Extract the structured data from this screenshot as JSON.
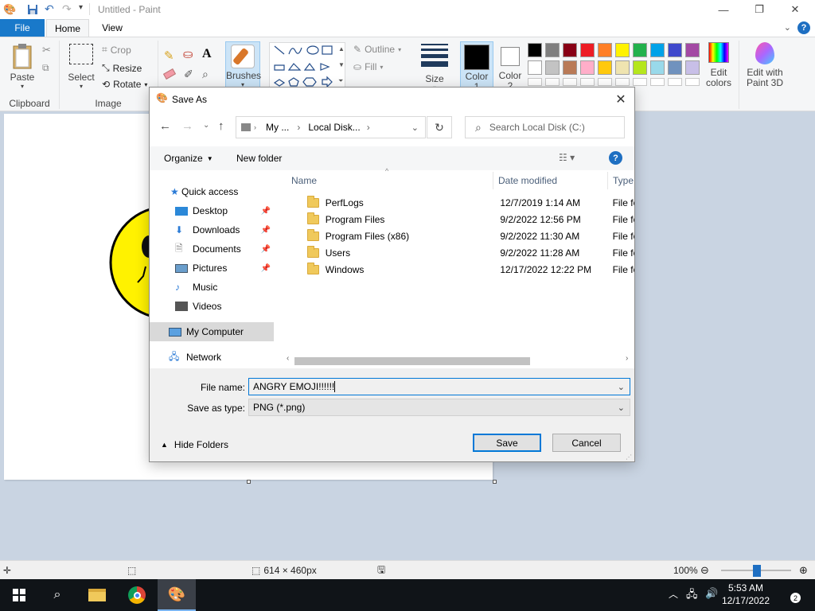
{
  "app": {
    "title": "Untitled - Paint",
    "window_buttons": [
      "—",
      "❐",
      "✕"
    ]
  },
  "ribbon_tabs": {
    "file": "File",
    "home": "Home",
    "view": "View"
  },
  "ribbon": {
    "clipboard": {
      "paste": "Paste",
      "group": "Clipboard"
    },
    "image": {
      "select": "Select",
      "crop": "Crop",
      "resize": "Resize",
      "rotate": "Rotate",
      "group": "Image"
    },
    "tools": {
      "text_tool": "A"
    },
    "brushes": "Brushes",
    "shapes": {
      "outline": "Outline",
      "fill": "Fill"
    },
    "size": "Size",
    "color1": "Color\n1",
    "color2": "Color\n2",
    "edit_colors": "Edit\ncolors",
    "paint3d": "Edit with\nPaint 3D",
    "palette_row1": [
      "#000000",
      "#7f7f7f",
      "#880015",
      "#ed1c24",
      "#ff7f27",
      "#fff200",
      "#22b14c",
      "#00a2e8",
      "#3f48cc",
      "#a349a4"
    ],
    "palette_row2": [
      "#ffffff",
      "#c3c3c3",
      "#b97a57",
      "#ffaec9",
      "#ffc90e",
      "#efe4b0",
      "#b5e61d",
      "#99d9ea",
      "#7092be",
      "#c8bfe7"
    ]
  },
  "status": {
    "dimensions": "614 × 460px",
    "zoom": "100%"
  },
  "taskbar": {
    "time": "5:53 AM",
    "date": "12/17/2022",
    "notification_count": "2"
  },
  "dialog": {
    "title": "Save As",
    "address": {
      "seg1": "My ...",
      "seg2": "Local Disk..."
    },
    "search_placeholder": "Search Local Disk (C:)",
    "organize": "Organize",
    "new_folder": "New folder",
    "nav": {
      "quick_access": "Quick access",
      "desktop": "Desktop",
      "downloads": "Downloads",
      "documents": "Documents",
      "pictures": "Pictures",
      "music": "Music",
      "videos": "Videos",
      "my_computer": "My Computer",
      "network": "Network"
    },
    "columns": {
      "name": "Name",
      "date": "Date modified",
      "type": "Type"
    },
    "files": [
      {
        "name": "PerfLogs",
        "date": "12/7/2019 1:14 AM",
        "type": "File fo"
      },
      {
        "name": "Program Files",
        "date": "9/2/2022 12:56 PM",
        "type": "File fo"
      },
      {
        "name": "Program Files (x86)",
        "date": "9/2/2022 11:30 AM",
        "type": "File fo"
      },
      {
        "name": "Users",
        "date": "9/2/2022 11:28 AM",
        "type": "File fo"
      },
      {
        "name": "Windows",
        "date": "12/17/2022 12:22 PM",
        "type": "File fo"
      }
    ],
    "file_name_label": "File name:",
    "file_name_value": "ANGRY EMOJI!!!!!!",
    "save_type_label": "Save as type:",
    "save_type_value": "PNG (*.png)",
    "hide_folders": "Hide Folders",
    "save": "Save",
    "cancel": "Cancel"
  }
}
